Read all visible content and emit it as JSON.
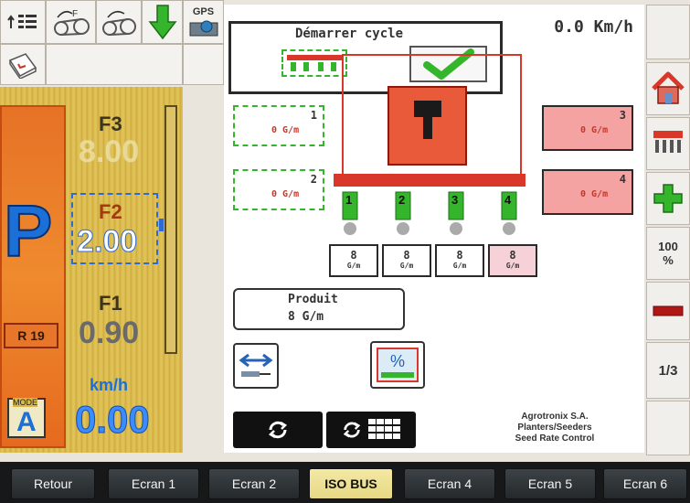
{
  "toolbar": {
    "gps_label": "GPS"
  },
  "gauges": {
    "f3_label": "F3",
    "f3_value": "8.00",
    "f2_label": "F2",
    "f2_value": "2.00",
    "f1_label": "F1",
    "f1_value": "0.90",
    "pto_letter": "P",
    "r_label": "R 19",
    "mode_label": "MODE",
    "mode_value": "A",
    "speed_unit": "km/h",
    "speed_value": "0.00"
  },
  "header": {
    "speed": "0.0 Km/h"
  },
  "start_cycle": {
    "title": "Démarrer cycle"
  },
  "rows": [
    {
      "num": "1",
      "value": "0 G/m"
    },
    {
      "num": "2",
      "value": "0 G/m"
    },
    {
      "num": "3",
      "value": "0 G/m"
    },
    {
      "num": "4",
      "value": "0 G/m"
    }
  ],
  "units": [
    "1",
    "2",
    "3",
    "4"
  ],
  "doses": [
    {
      "n": "8",
      "u": "G/m"
    },
    {
      "n": "8",
      "u": "G/m"
    },
    {
      "n": "8",
      "u": "G/m"
    },
    {
      "n": "8",
      "u": "G/m"
    }
  ],
  "product": {
    "label": "Produit",
    "value": "8 G/m"
  },
  "info": {
    "line1": "Agrotronix S.A.",
    "line2": "Planters/Seeders",
    "line3": "Seed Rate Control"
  },
  "right_bar": {
    "percent": "100",
    "percent_unit": "%",
    "page": "1/3"
  },
  "tabs": [
    "Retour",
    "Ecran 1",
    "Ecran 2",
    "ISO BUS",
    "Ecran 4",
    "Ecran 5",
    "Ecran 6"
  ],
  "colors": {
    "accent_green": "#35b52b",
    "active_tab": "#ece08f",
    "planter_red": "#d8372a"
  }
}
